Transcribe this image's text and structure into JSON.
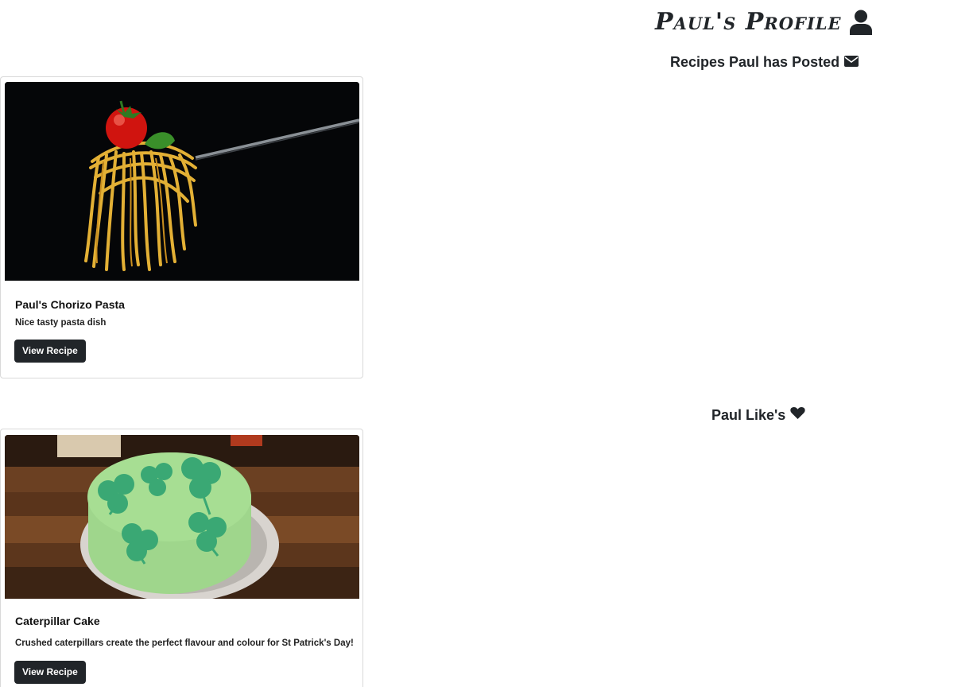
{
  "profile": {
    "title": "Paul's Profile",
    "title_icon": "user-icon"
  },
  "posted": {
    "heading": "Recipes Paul has Posted",
    "icon": "envelope-icon",
    "recipes": [
      {
        "title": "Paul's Chorizo Pasta",
        "description": "Nice tasty pasta dish",
        "button_label": "View Recipe"
      }
    ]
  },
  "liked": {
    "heading": "Paul Like's",
    "icon": "heart-icon",
    "recipes": [
      {
        "title": "Caterpillar Cake",
        "description": "Crushed caterpillars create the perfect flavour and colour for St Patrick's Day!",
        "button_label": "View Recipe"
      }
    ]
  },
  "colors": {
    "text": "#212529",
    "button_bg": "#212529",
    "button_text": "#ffffff",
    "card_border": "#d9d9d9"
  }
}
